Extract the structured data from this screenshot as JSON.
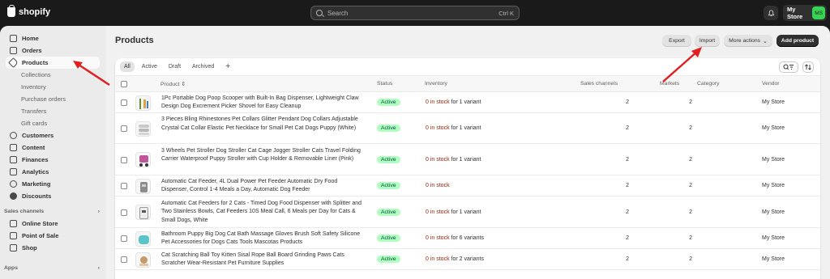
{
  "topbar": {
    "brand": "shopify",
    "search_placeholder": "Search",
    "shortcut": "Ctrl K",
    "store_name": "My Store",
    "avatar_initials": "MS"
  },
  "sidebar": {
    "items": [
      {
        "label": "Home",
        "icon": "home-icon"
      },
      {
        "label": "Orders",
        "icon": "inbox-icon"
      },
      {
        "label": "Products",
        "icon": "tag-icon",
        "active": true
      }
    ],
    "product_subitems": [
      "Collections",
      "Inventory",
      "Purchase orders",
      "Transfers",
      "Gift cards"
    ],
    "items2": [
      {
        "label": "Customers",
        "icon": "person-icon"
      },
      {
        "label": "Content",
        "icon": "file-icon"
      },
      {
        "label": "Finances",
        "icon": "bank-icon"
      },
      {
        "label": "Analytics",
        "icon": "chart-icon"
      },
      {
        "label": "Marketing",
        "icon": "target-icon"
      },
      {
        "label": "Discounts",
        "icon": "discount-icon"
      }
    ],
    "sales_channels_label": "Sales channels",
    "channels": [
      {
        "label": "Online Store",
        "icon": "store-icon"
      },
      {
        "label": "Point of Sale",
        "icon": "pos-icon"
      },
      {
        "label": "Shop",
        "icon": "shop-icon"
      }
    ],
    "apps_label": "Apps"
  },
  "page": {
    "title": "Products",
    "export_label": "Export",
    "import_label": "Import",
    "more_actions_label": "More actions",
    "add_product_label": "Add product"
  },
  "tabs": [
    "All",
    "Active",
    "Draft",
    "Archived",
    "+"
  ],
  "table": {
    "headers": {
      "product": "Product",
      "status": "Status",
      "inventory": "Inventory",
      "sales_channels": "Sales channels",
      "markets": "Markets",
      "category": "Category",
      "vendor": "Vendor"
    },
    "rows": [
      {
        "name": "1Pc Portable Dog Poop Scooper with Built-In Bag Dispenser, Lightweight Claw Design Dog Excrement Picker Shovel for Easy Cleanup",
        "status": "Active",
        "stock": "0 in stock",
        "variants": " for 1 variant",
        "channels": "2",
        "markets": "2",
        "vendor": "My Store"
      },
      {
        "name": "3 Pieces Bling Rhinestones Pet Collars Glitter Pendant Dog Collars Adjustable Crystal Cat Collar Elastic Pet Necklace for Small Pet Cat Dogs Puppy (White)",
        "status": "Active",
        "stock": "0 in stock",
        "variants": " for 1 variant",
        "channels": "2",
        "markets": "2",
        "vendor": "My Store"
      },
      {
        "name": "3 Wheels Pet Stroller Dog Stroller Cat Cage Jogger Stroller Cats Travel Folding Carrier Waterproof Puppy Stroller with Cup Holder & Removable Liner (Pink)",
        "status": "Active",
        "stock": "0 in stock",
        "variants": " for 1 variant",
        "channels": "2",
        "markets": "2",
        "vendor": "My Store"
      },
      {
        "name": "Automatic Cat Feeder, 4L Dual Power Pet Feeder Automatic Dry Food Dispenser, Control 1-4 Meals a Day, Automatic Dog Feeder",
        "status": "Active",
        "stock": "0 in stock",
        "variants": "",
        "channels": "2",
        "markets": "2",
        "vendor": "My Store"
      },
      {
        "name": "Automatic Cat Feeders for 2 Cats - Timed Dog Food Dispenser with Splitter and Two Stainless Bowls, Cat Feeders 10S Meal Call, 6 Meals per Day for Cats & Small Dogs, White",
        "status": "Active",
        "stock": "0 in stock",
        "variants": " for 1 variant",
        "channels": "2",
        "markets": "2",
        "vendor": "My Store"
      },
      {
        "name": "Bathroom Puppy Big Dog Cat Bath Massage Gloves Brush Soft Safety Silicone Pet Accessories for Dogs Cats Tools Mascotas Products",
        "status": "Active",
        "stock": "0 in stock",
        "variants": " for 6 variants",
        "channels": "2",
        "markets": "2",
        "vendor": "My Store"
      },
      {
        "name": "Cat Scratching Ball Toy Kitten Sisal Rope Ball Board Grinding Paws Cats Scratcher Wear-Resistant Pet Furniture Supplies",
        "status": "Active",
        "stock": "0 in stock",
        "variants": " for 2 variants",
        "channels": "2",
        "markets": "2",
        "vendor": "My Store"
      }
    ]
  },
  "colors": {
    "topbar": "#1a1a1a",
    "active_badge_bg": "#affebf",
    "out_of_stock_text": "#8e1f0b",
    "annotation_arrow": "#e02020"
  }
}
